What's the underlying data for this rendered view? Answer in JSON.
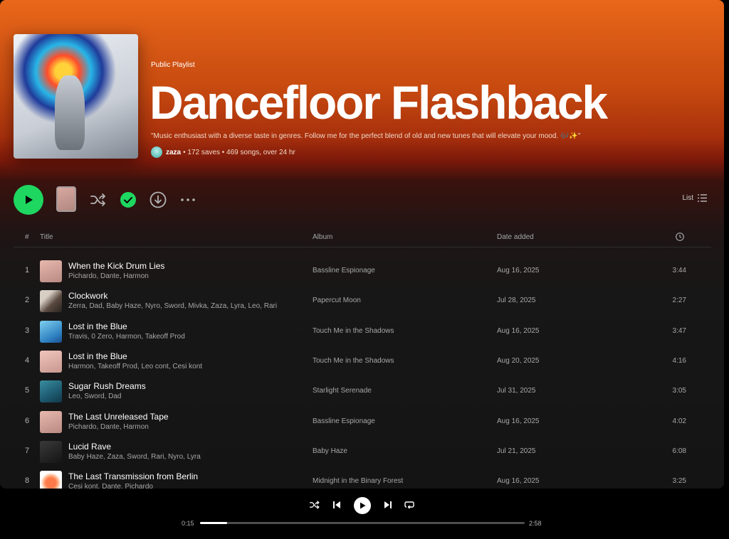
{
  "header": {
    "type_label": "Public Playlist",
    "title": "Dancefloor Flashback",
    "description": "\"Music enthusiast with a diverse taste in genres. Follow me for the perfect blend of old and new tunes that will elevate your mood. 🎶✨\"",
    "owner": "zaza",
    "stats": "• 172 saves • 469 songs, over 24 hr"
  },
  "controls": {
    "view_label": "List",
    "accent_color": "#1ed760"
  },
  "table": {
    "columns": {
      "num": "#",
      "title": "Title",
      "album": "Album",
      "date": "Date added"
    },
    "rows": [
      {
        "num": "1",
        "title": "When the Kick Drum Lies",
        "artists": "Pichardo, Dante, Harmon",
        "album": "Bassline Espionage",
        "date": "Aug 16, 2025",
        "duration": "3:44",
        "art": "pink"
      },
      {
        "num": "2",
        "title": "Clockwork",
        "artists": "Zerra, Dad, Baby Haze, Nyro, Sword, Mivka, Zaza, Lyra, Leo, Rari",
        "album": "Papercut Moon",
        "date": "Jul 28, 2025",
        "duration": "2:27",
        "art": "tan"
      },
      {
        "num": "3",
        "title": "Lost in the Blue",
        "artists": "Travis, 0 Zero, Harmon, Takeoff Prod",
        "album": "Touch Me in the Shadows",
        "date": "Aug 16, 2025",
        "duration": "3:47",
        "art": "blue"
      },
      {
        "num": "4",
        "title": "Lost in the Blue",
        "artists": "Harmon, Takeoff Prod, Leo cont, Cesi kont",
        "album": "Touch Me in the Shadows",
        "date": "Aug 20, 2025",
        "duration": "4:16",
        "art": "bow"
      },
      {
        "num": "5",
        "title": "Sugar Rush Dreams",
        "artists": "Leo, Sword, Dad",
        "album": "Starlight Serenade",
        "date": "Jul 31, 2025",
        "duration": "3:05",
        "art": "teal"
      },
      {
        "num": "6",
        "title": "The Last Unreleased Tape",
        "artists": "Pichardo, Dante, Harmon",
        "album": "Bassline Espionage",
        "date": "Aug 16, 2025",
        "duration": "4:02",
        "art": "pink"
      },
      {
        "num": "7",
        "title": "Lucid Rave",
        "artists": "Baby Haze, Zaza, Sword, Rari, Nyro, Lyra",
        "album": "Baby Haze",
        "date": "Jul 21, 2025",
        "duration": "6:08",
        "art": "dark"
      },
      {
        "num": "8",
        "title": "The Last Transmission from Berlin",
        "artists": "Cesi kont, Dante, Pichardo",
        "album": "Midnight in the Binary Forest",
        "date": "Aug 16, 2025",
        "duration": "3:25",
        "art": "sun"
      }
    ]
  },
  "player": {
    "elapsed": "0:15",
    "total": "2:58",
    "progress": 0.084
  }
}
